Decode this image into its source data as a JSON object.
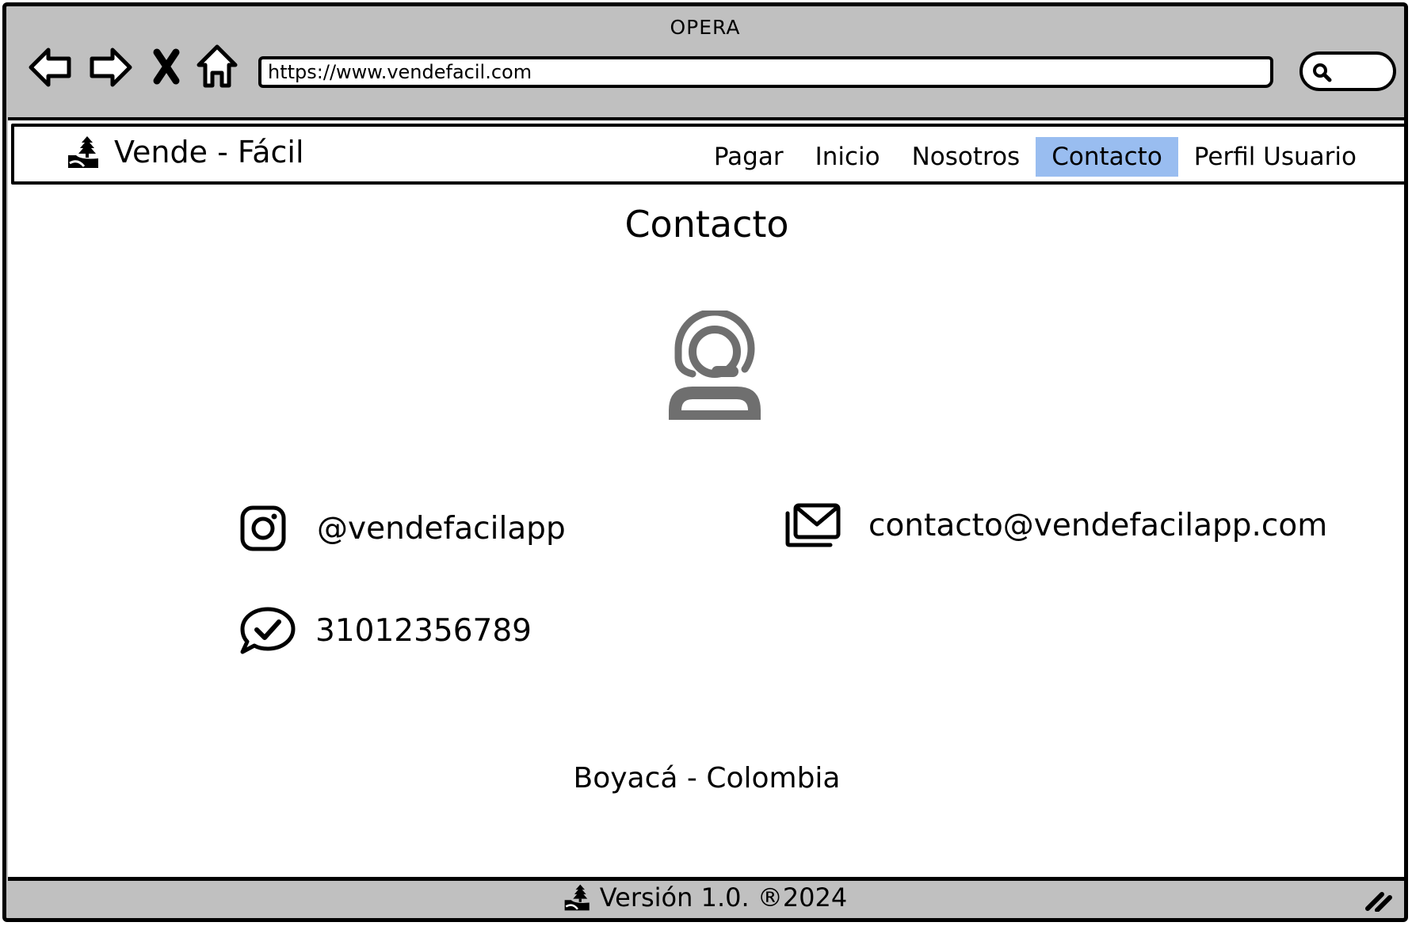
{
  "browser": {
    "title": "OPERA",
    "url": "https://www.vendefacil.com"
  },
  "navbar": {
    "brand": "Vende - Fácil",
    "items": [
      {
        "label": "Pagar",
        "active": false
      },
      {
        "label": "Inicio",
        "active": false
      },
      {
        "label": "Nosotros",
        "active": false
      },
      {
        "label": "Contacto",
        "active": true
      },
      {
        "label": "Perfil Usuario",
        "active": false
      }
    ],
    "active_color": "#99bdf0"
  },
  "page": {
    "title": "Contacto",
    "instagram": "@vendefacilapp",
    "email": "contacto@vendefacilapp.com",
    "phone": "31012356789",
    "location": "Boyacá - Colombia"
  },
  "footer": {
    "text": "Versión 1.0.  ®2024"
  },
  "icons": [
    "back-arrow-icon",
    "forward-arrow-icon",
    "close-icon",
    "home-icon",
    "search-icon",
    "logo-icon",
    "support-agent-icon",
    "instagram-icon",
    "email-icon",
    "whatsapp-icon",
    "resize-handle-icon"
  ]
}
